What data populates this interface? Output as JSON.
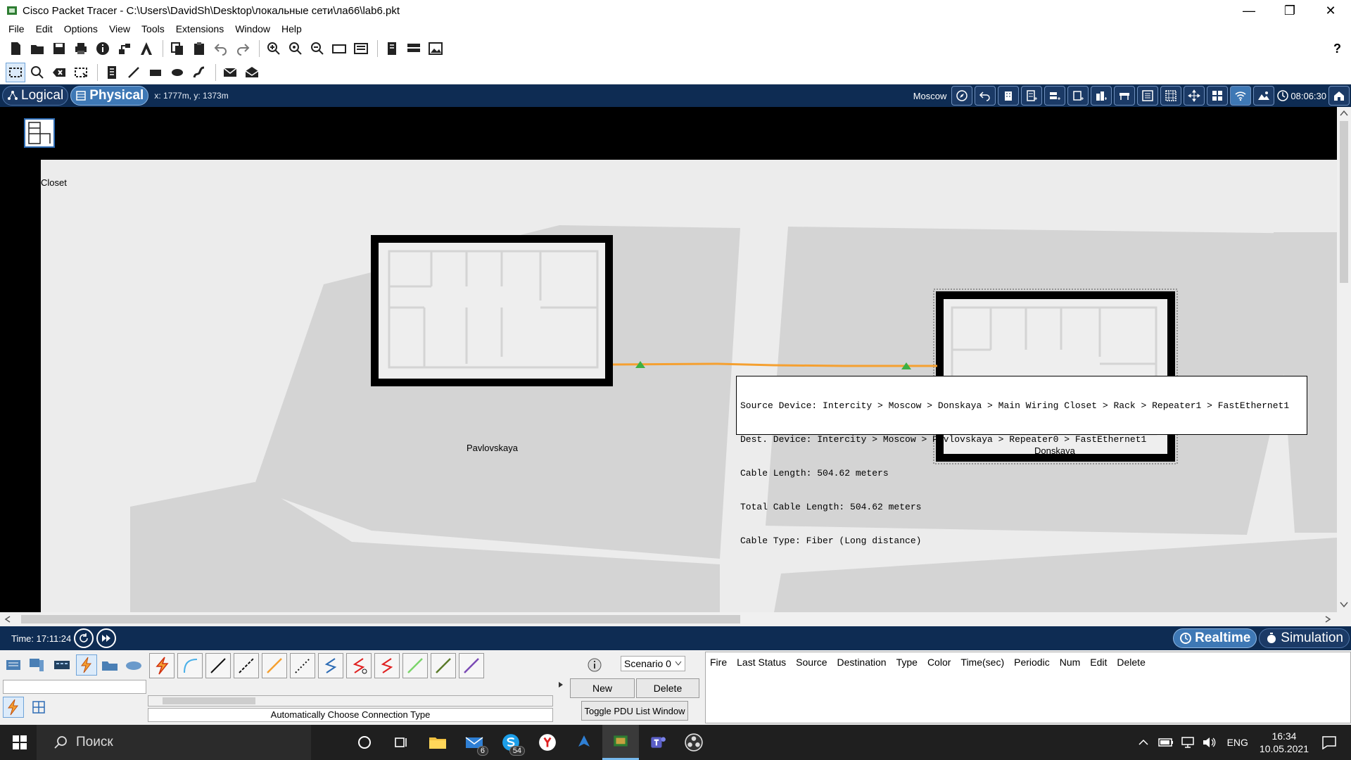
{
  "window": {
    "title": "Cisco Packet Tracer - C:\\Users\\DavidSh\\Desktop\\локальные сети\\ла66\\lab6.pkt",
    "minimize": "—",
    "maximize": "❐",
    "close": "✕"
  },
  "menu": [
    "File",
    "Edit",
    "Options",
    "View",
    "Tools",
    "Extensions",
    "Window",
    "Help"
  ],
  "toolbar": {
    "help": "?"
  },
  "nav": {
    "logical_label": "Logical",
    "physical_label": "Physical",
    "coords": "x: 1777m, y: 1373m",
    "location": "Moscow",
    "clock": "08:06:30"
  },
  "canvas": {
    "closet_label": "Closet",
    "building_left": "Pavlovskaya",
    "building_right": "Donskaya",
    "link_color": "#f5a030"
  },
  "tooltip": {
    "source": "Source Device: Intercity > Moscow > Donskaya > Main Wiring Closet > Rack > Repeater1 > FastEthernet1",
    "dest": "Dest. Device: Intercity > Moscow > Pavlovskaya > Repeater0 > FastEthernet1",
    "length": "Cable Length: 504.62 meters",
    "total": "Total Cable Length: 504.62 meters",
    "type": "Cable Type: Fiber (Long distance)"
  },
  "timebar": {
    "time": "Time: 17:11:24",
    "realtime": "Realtime",
    "simulation": "Simulation"
  },
  "device_panel": {
    "search_value": "",
    "connection_hint": "Automatically Choose Connection Type"
  },
  "pdu": {
    "scenario": "Scenario 0",
    "new": "New",
    "delete": "Delete",
    "toggle": "Toggle PDU List Window",
    "columns": [
      "Fire",
      "Last Status",
      "Source",
      "Destination",
      "Type",
      "Color",
      "Time(sec)",
      "Periodic",
      "Num",
      "Edit",
      "Delete"
    ]
  },
  "taskbar": {
    "search_placeholder": "Поиск",
    "mail_badge": "6",
    "skype_badge": "54",
    "lang": "ENG",
    "time": "16:34",
    "date": "10.05.2021"
  }
}
